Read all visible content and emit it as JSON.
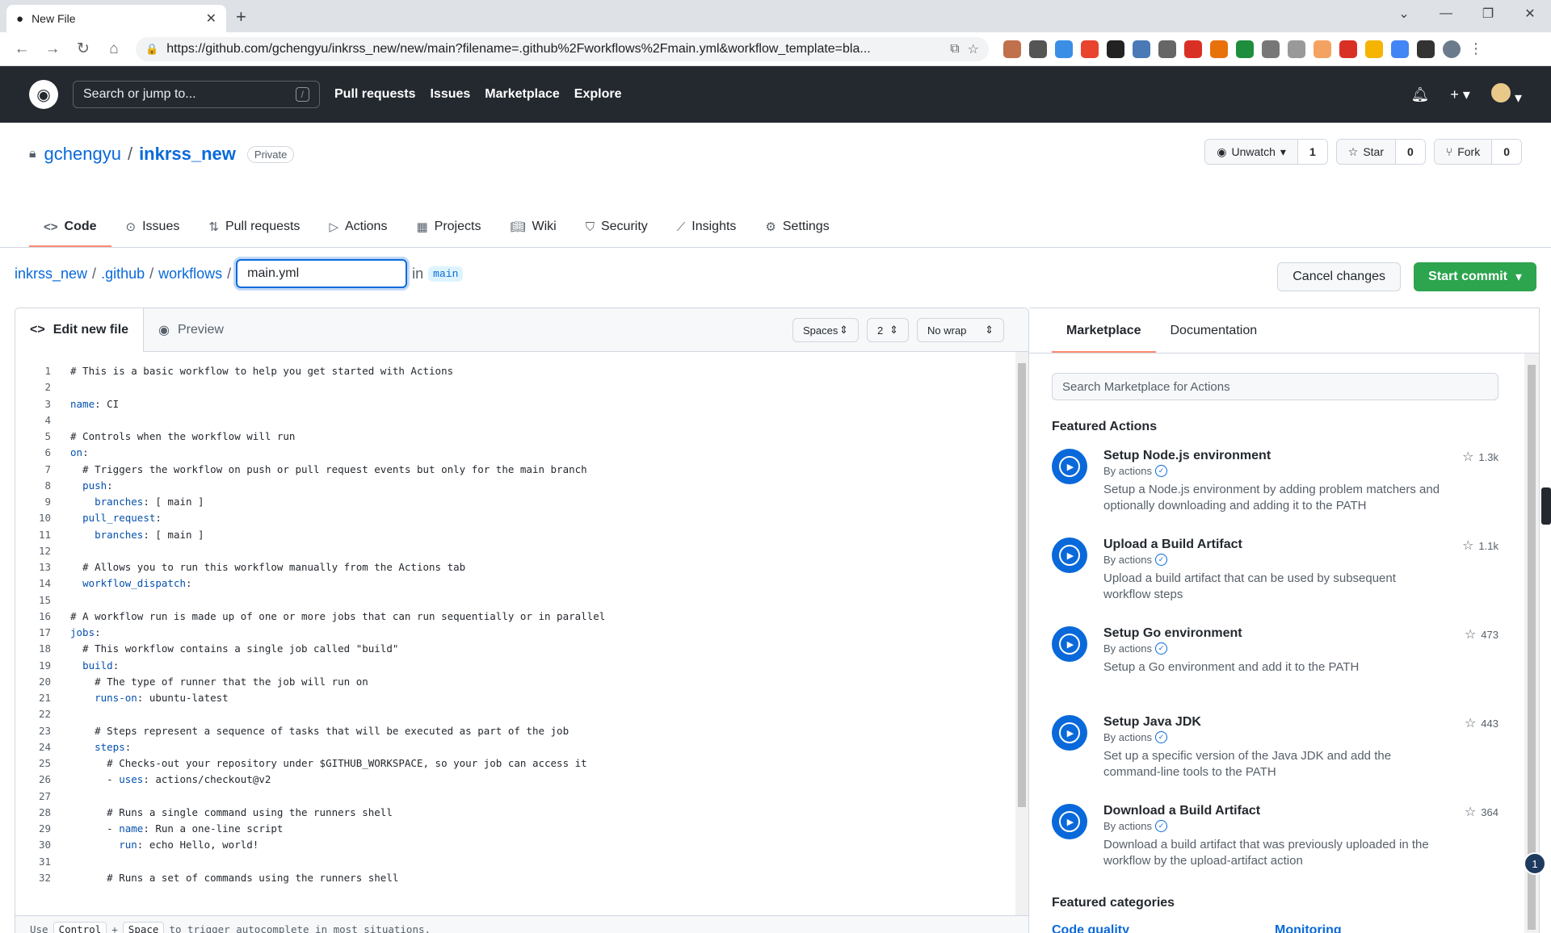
{
  "browser": {
    "tab_title": "New File",
    "url": "https://github.com/gchengyu/inkrss_new/new/main?filename=.github%2Fworkflows%2Fmain.yml&workflow_template=bla..."
  },
  "gh_header": {
    "search_placeholder": "Search or jump to...",
    "search_shortcut": "/",
    "nav": [
      "Pull requests",
      "Issues",
      "Marketplace",
      "Explore"
    ]
  },
  "repo": {
    "owner": "gchengyu",
    "name": "inkrss_new",
    "visibility": "Private",
    "unwatch_label": "Unwatch",
    "watch_count": "1",
    "star_label": "Star",
    "star_count": "0",
    "fork_label": "Fork",
    "fork_count": "0",
    "tabs": [
      "Code",
      "Issues",
      "Pull requests",
      "Actions",
      "Projects",
      "Wiki",
      "Security",
      "Insights",
      "Settings"
    ]
  },
  "path": {
    "root": "inkrss_new",
    "dir1": ".github",
    "dir2": "workflows",
    "filename": "main.yml",
    "in_label": "in",
    "branch": "main",
    "cancel_label": "Cancel changes",
    "commit_label": "Start commit"
  },
  "editor": {
    "tab_edit": "Edit new file",
    "tab_preview": "Preview",
    "indent_mode": "Spaces",
    "indent_size": "2",
    "wrap_mode": "No wrap",
    "footer_pre": "Use",
    "footer_key1": "Control",
    "footer_plus": "+",
    "footer_key2": "Space",
    "footer_post": "to trigger autocomplete in most situations.",
    "lines": [
      "# This is a basic workflow to help you get started with Actions",
      "",
      "name: CI",
      "",
      "# Controls when the workflow will run",
      "on:",
      "  # Triggers the workflow on push or pull request events but only for the main branch",
      "  push:",
      "    branches: [ main ]",
      "  pull_request:",
      "    branches: [ main ]",
      "",
      "  # Allows you to run this workflow manually from the Actions tab",
      "  workflow_dispatch:",
      "",
      "# A workflow run is made up of one or more jobs that can run sequentially or in parallel",
      "jobs:",
      "  # This workflow contains a single job called \"build\"",
      "  build:",
      "    # The type of runner that the job will run on",
      "    runs-on: ubuntu-latest",
      "",
      "    # Steps represent a sequence of tasks that will be executed as part of the job",
      "    steps:",
      "      # Checks-out your repository under $GITHUB_WORKSPACE, so your job can access it",
      "      - uses: actions/checkout@v2",
      "",
      "      # Runs a single command using the runners shell",
      "      - name: Run a one-line script",
      "        run: echo Hello, world!",
      "",
      "      # Runs a set of commands using the runners shell"
    ]
  },
  "sidebar": {
    "tab_marketplace": "Marketplace",
    "tab_docs": "Documentation",
    "search_placeholder": "Search Marketplace for Actions",
    "featured_heading": "Featured Actions",
    "actions": [
      {
        "name": "Setup Node.js environment",
        "by": "By actions",
        "desc": "Setup a Node.js environment by adding problem matchers and optionally downloading and adding it to the PATH",
        "stars": "1.3k"
      },
      {
        "name": "Upload a Build Artifact",
        "by": "By actions",
        "desc": "Upload a build artifact that can be used by subsequent workflow steps",
        "stars": "1.1k"
      },
      {
        "name": "Setup Go environment",
        "by": "By actions",
        "desc": "Setup a Go environment and add it to the PATH",
        "stars": "473"
      },
      {
        "name": "Setup Java JDK",
        "by": "By actions",
        "desc": "Set up a specific version of the Java JDK and add the command-line tools to the PATH",
        "stars": "443"
      },
      {
        "name": "Download a Build Artifact",
        "by": "By actions",
        "desc": "Download a build artifact that was previously uploaded in the workflow by the upload-artifact action",
        "stars": "364"
      }
    ],
    "categories_heading": "Featured categories",
    "categories": [
      "Code quality",
      "Monitoring"
    ]
  },
  "float_badge": "1",
  "colors": {
    "accent": "#0969da",
    "commit_green": "#2da44e",
    "header_dark": "#24292f"
  }
}
